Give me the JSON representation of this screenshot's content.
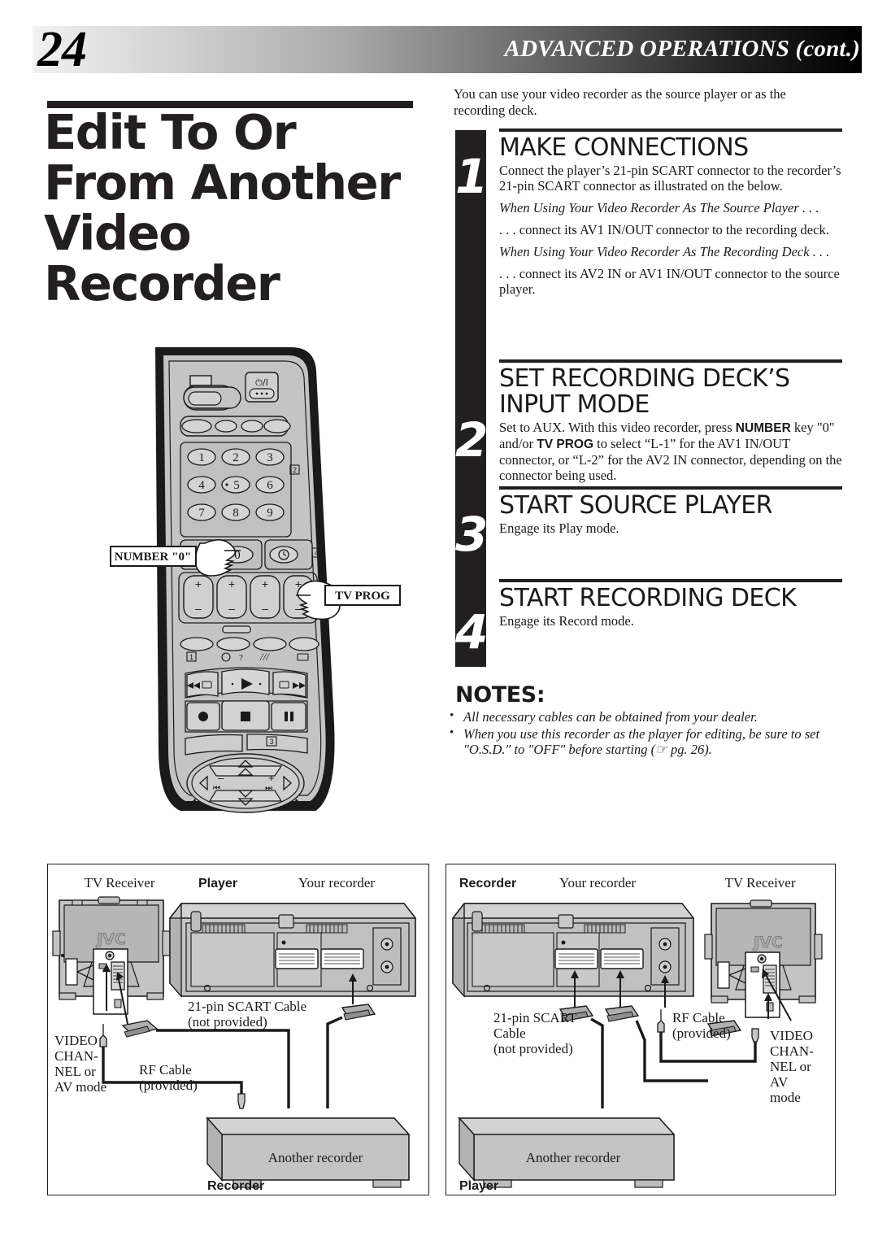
{
  "header": {
    "page_number": "24",
    "section_title": "ADVANCED OPERATIONS (cont.)"
  },
  "article": {
    "title": "Edit To Or From Another Video Recorder",
    "intro": "You can use your video recorder as the source player or as the recording deck."
  },
  "steps": [
    {
      "number": "1",
      "heading": "MAKE CONNECTIONS",
      "body_1": "Connect the player’s 21-pin SCART connector to the recorder’s 21-pin SCART connector as illustrated on the below.",
      "sub_1_title": "When Using Your Video Recorder As The Source Player . . .",
      "sub_1_body": ". . . connect its AV1 IN/OUT connector to the recording deck.",
      "sub_2_title": "When Using Your Video Recorder As The Recording Deck . . .",
      "sub_2_body": " . . . connect its AV2 IN or AV1 IN/OUT connector to the source player."
    },
    {
      "number": "2",
      "heading": "SET RECORDING DECK’S INPUT MODE",
      "body_pre": "Set to AUX. With this video recorder, press ",
      "body_b1": "NUMBER",
      "body_mid": " key \"0\" and/or ",
      "body_b2": "TV PROG",
      "body_post": " to select “L-1” for the AV1 IN/OUT connector, or “L-2” for the AV2 IN connector, depending on the connector being used."
    },
    {
      "number": "3",
      "heading": "START SOURCE PLAYER",
      "body_1": "Engage its Play mode."
    },
    {
      "number": "4",
      "heading": "START RECORDING DECK",
      "body_1": "Engage its Record mode."
    }
  ],
  "notes": {
    "title": "NOTES:",
    "items": [
      "All necessary cables can be obtained from your dealer.",
      "When you use this recorder as the player for editing, be sure to set \"O.S.D.\" to  \"OFF\" before starting (☞ pg. 26)."
    ]
  },
  "remote": {
    "callout_number": "NUMBER \"0\"",
    "callout_tvprog": "TV PROG",
    "keys": [
      "1",
      "2",
      "3",
      "4",
      "5",
      "6",
      "7",
      "8",
      "9",
      "0"
    ],
    "marker_2": "2",
    "marker_4": "4",
    "marker_1": "1",
    "marker_3": "3",
    "plus_labels": [
      "+",
      "+",
      "+",
      "+"
    ],
    "minus_labels": [
      "–",
      "–",
      "–",
      "–"
    ],
    "power_label": "⏻/I",
    "help_label": "?"
  },
  "diagrams": [
    {
      "id": "source-player-diagram",
      "tv_label": "TV Receiver",
      "brand": "JVC",
      "deck_top_label": "Player",
      "deck_top_label_bold": true,
      "your_recorder_label": "Your recorder",
      "scart_label": "21-pin SCART Cable\n(not provided)",
      "scart_label_l1": "21-pin SCART Cable",
      "scart_label_l2": "(not provided)",
      "rf_label_l1": "RF Cable",
      "rf_label_l2": "(provided)",
      "video_mode_label": "VIDEO\nCHAN-\nNEL or\nAV mode",
      "video_mode_lines": [
        "VIDEO",
        "CHAN-",
        "NEL or",
        "AV mode"
      ],
      "bottom_device_label": "Another recorder",
      "bottom_role_label": "Recorder"
    },
    {
      "id": "recording-deck-diagram",
      "deck_top_label": "Recorder",
      "deck_top_label_bold": true,
      "your_recorder_label": "Your recorder",
      "tv_label": "TV Receiver",
      "brand": "JVC",
      "scart_label_l1": "21-pin SCART",
      "scart_label_l2": "Cable",
      "scart_label_l3": "(not provided)",
      "rf_label_l1": "RF Cable",
      "rf_label_l2": "(provided)",
      "video_mode_lines": [
        "VIDEO",
        "CHAN-",
        "NEL or",
        "AV",
        "mode"
      ],
      "bottom_device_label": "Another recorder",
      "bottom_role_label": "Player"
    }
  ],
  "colors": {
    "ink": "#231f20",
    "device_gray": "#c4c4c4",
    "device_gray_dark": "#9a9a9a",
    "device_gray_light": "#d8d8d8"
  }
}
